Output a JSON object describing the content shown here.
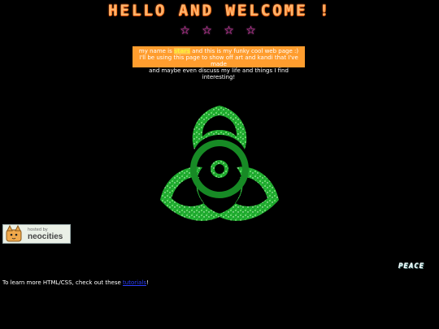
{
  "header": {
    "title": "HELLO AND WELCOME !"
  },
  "stars_row": {
    "stars": [
      "☆",
      "☆",
      "☆",
      "☆"
    ]
  },
  "intro": {
    "line1_before": "my name is ",
    "name": "stars",
    "line1_after": " and this is my funky cool web page :)",
    "line2": "I'll be using this page to show off art and kandi that I've made",
    "line3": "and maybe even discuss my life and things I find interesting!"
  },
  "graphics": {
    "main": "biohazard-icon",
    "glitter_color": "#27c93a"
  },
  "badge": {
    "small_text": "hosted by",
    "big_text": "neocities"
  },
  "peace_text": "PEACE",
  "footer": {
    "text_before": "To learn more HTML/CSS, check out these ",
    "link_text": "tutorials",
    "text_after": "!"
  }
}
